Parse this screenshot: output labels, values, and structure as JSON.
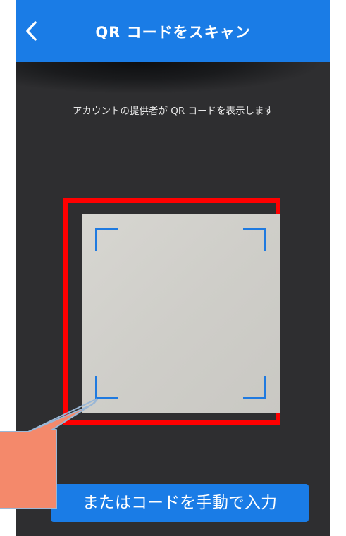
{
  "header": {
    "title": "QR コードをスキャン",
    "back_icon": "chevron-left-icon",
    "background_color": "#1a7ce6"
  },
  "instruction": "アカウントの提供者が QR コードを表示します",
  "scanner": {
    "frame_color": "#1f7ae0",
    "highlight_color": "#ff0000"
  },
  "manual_entry_button": {
    "label": "またはコードを手動で入力"
  },
  "annotation": {
    "arrow_color": "#f4896b",
    "arrow_outline": "#9ab7d6"
  }
}
